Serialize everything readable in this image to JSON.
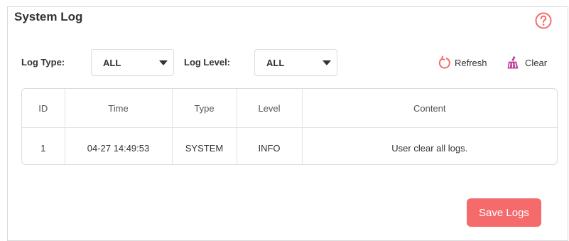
{
  "page": {
    "title": "System Log"
  },
  "filters": {
    "log_type_label": "Log Type:",
    "log_type_value": "ALL",
    "log_level_label": "Log Level:",
    "log_level_value": "ALL"
  },
  "toolbar": {
    "refresh_label": "Refresh",
    "refresh_icon": "refresh-icon",
    "clear_label": "Clear",
    "clear_icon": "broom-icon"
  },
  "table": {
    "columns": [
      "ID",
      "Time",
      "Type",
      "Level",
      "Content"
    ],
    "rows": [
      [
        "1",
        "04-27 14:49:53",
        "SYSTEM",
        "INFO",
        "User clear all logs."
      ]
    ]
  },
  "actions": {
    "save_logs_label": "Save Logs"
  },
  "colors": {
    "accent": "#f56b6b",
    "text": "#333333",
    "border": "#dcdcdc"
  }
}
